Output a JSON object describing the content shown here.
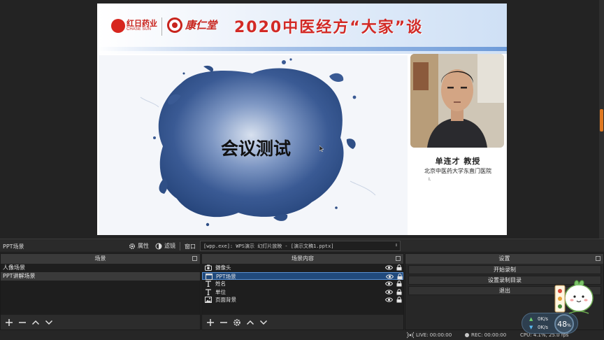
{
  "preview": {
    "banner": {
      "logo1_cn": "红日药业",
      "logo1_en": "CHASE SUN",
      "logo2_cn": "康仁堂",
      "title": "2020中医经方“大家”谈"
    },
    "slide": {
      "title": "会议测试"
    },
    "speaker": {
      "name": "单连才  教授",
      "organization": "北京中医药大学东直门医院",
      "mark": "I."
    }
  },
  "context_bar": {
    "scene_label": "PPT场景",
    "properties_label": "属性",
    "filters_label": "滤镜",
    "window_label": "窗口",
    "window_value": "[wpp.exe]: WPS演示 幻灯片放映 - [演示文稿1.pptx]"
  },
  "scenes": {
    "title": "场景",
    "items": [
      {
        "label": "人像场景",
        "selected": false
      },
      {
        "label": "PPT讲解场景",
        "selected": true
      }
    ]
  },
  "sources": {
    "title": "场景内容",
    "items": [
      {
        "label": "摄像头",
        "icon": "camera-icon",
        "selected": false
      },
      {
        "label": "PPT场景",
        "icon": "window-icon",
        "selected": true
      },
      {
        "label": "姓名",
        "icon": "text-icon",
        "selected": false
      },
      {
        "label": "单位",
        "icon": "text-icon",
        "selected": false
      },
      {
        "label": "页面背景",
        "icon": "image-icon",
        "selected": false
      }
    ]
  },
  "controls": {
    "title": "设置",
    "start_recording": "开始录制",
    "recording_dir": "设置录制目录",
    "exit": "退出"
  },
  "status": {
    "live": "LIVE: 00:00:00",
    "rec": "REC: 00:00:00",
    "cpu": "CPU: 4.1%, 25.0 fps"
  },
  "net_widget": {
    "up": "0K/s",
    "down": "0K/s",
    "percent": "48",
    "percent_sign": "%"
  },
  "colors": {
    "accent_orange": "#e07820",
    "selection_blue": "#214a7c",
    "banner_red": "#d22a26",
    "ink_blue": "#2f4f86"
  }
}
